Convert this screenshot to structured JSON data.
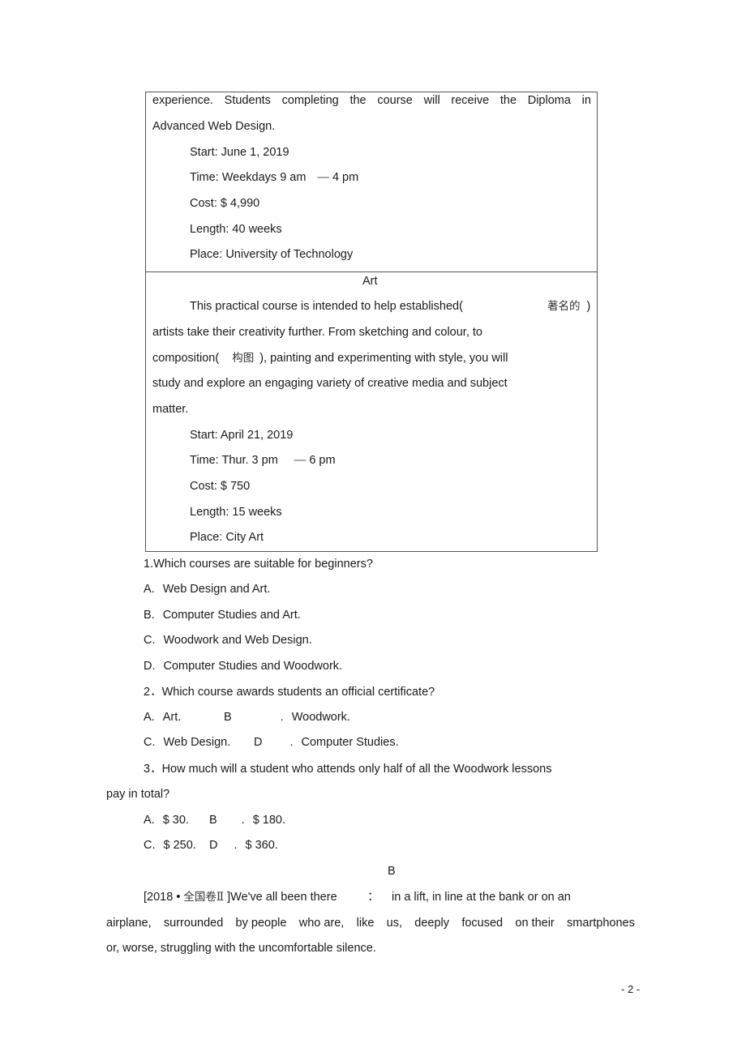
{
  "web_design_course": {
    "description_line1_words": [
      "experience.",
      "Students",
      "completing",
      "the",
      "course",
      "will",
      "receive",
      "the",
      "Diploma",
      "in"
    ],
    "description_line2": "Advanced Web Design.",
    "start": "Start: June 1, 2019",
    "time_prefix": "Time: Weekdays 9 am",
    "time_dash": "—",
    "time_suffix": "4 pm",
    "cost": "Cost: $ 4,990",
    "length": "Length: 40 weeks",
    "place": "Place: University of Technology"
  },
  "art_course": {
    "title": "Art",
    "line1_text": "This practical course is intended to help established(",
    "line1_cn": "著名的",
    "line1_close": ")",
    "line2": "artists take their creativity further. From sketching and colour, to",
    "line3_pre": "composition(",
    "line3_cn": "构图",
    "line3_post": "), painting and experimenting with style, you will",
    "line4": "study and explore an engaging variety of creative media and subject",
    "line5": "matter.",
    "start": "Start: April 21, 2019",
    "time_prefix": "Time: Thur. 3 pm",
    "time_dash": "—",
    "time_suffix": "6 pm",
    "cost": "Cost: $ 750",
    "length": "Length: 15 weeks",
    "place": "Place: City Art"
  },
  "questions": {
    "q1": {
      "stem": "1.Which courses are suitable for beginners?",
      "options": [
        {
          "letter": "A.",
          "text": "Web Design and Art."
        },
        {
          "letter": "B.",
          "text": "Computer Studies and Art."
        },
        {
          "letter": "C.",
          "text": "Woodwork and Web Design."
        },
        {
          "letter": "D.",
          "text": "Computer Studies and Woodwork."
        }
      ]
    },
    "q2": {
      "stem_num": "2．",
      "stem": "Which course awards students an official certificate?",
      "options": [
        {
          "letter": "A.",
          "text": "Art."
        },
        {
          "letter": "B",
          "dot": ".",
          "text": "Woodwork."
        },
        {
          "letter": "C.",
          "text": "Web Design."
        },
        {
          "letter": "D",
          "dot": ".",
          "text": "Computer Studies."
        }
      ]
    },
    "q3": {
      "stem_num": "3．",
      "stem": "How much will a student who attends only half of all the Woodwork lessons",
      "stem_cont": "pay in total?",
      "options": [
        {
          "letter": "A.",
          "text": "$ 30."
        },
        {
          "letter": "B",
          "dot": ".",
          "text": "$ 180."
        },
        {
          "letter": "C.",
          "text": "$ 250."
        },
        {
          "letter": "D",
          "dot": ".",
          "text": "$ 360."
        }
      ]
    }
  },
  "passage_b": {
    "heading": "B",
    "source_open": "[2018 • ",
    "source_cn": "全国卷Ⅱ",
    "source_close": " ]We've all been there",
    "colon": "：",
    "line1_rest": "in a lift, in line at the bank or on an",
    "line2_words": [
      "airplane,",
      "surrounded",
      "by people",
      "who are,",
      "like",
      "us,",
      "deeply",
      "focused",
      "on their",
      "smartphones"
    ],
    "line3": "or, worse, struggling with the uncomfortable silence."
  },
  "page_number": "- 2 -"
}
